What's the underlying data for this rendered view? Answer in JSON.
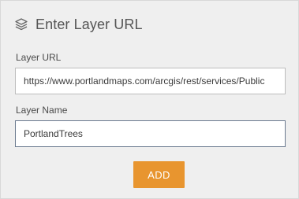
{
  "header": {
    "title": "Enter Layer URL",
    "icon": "layers-icon"
  },
  "layer_url": {
    "label": "Layer URL",
    "value": "https://www.portlandmaps.com/arcgis/rest/services/Public"
  },
  "layer_name": {
    "label": "Layer Name",
    "value": "PortlandTrees"
  },
  "actions": {
    "add_label": "ADD"
  },
  "colors": {
    "accent": "#e8952f",
    "panel_background": "#efefef"
  }
}
